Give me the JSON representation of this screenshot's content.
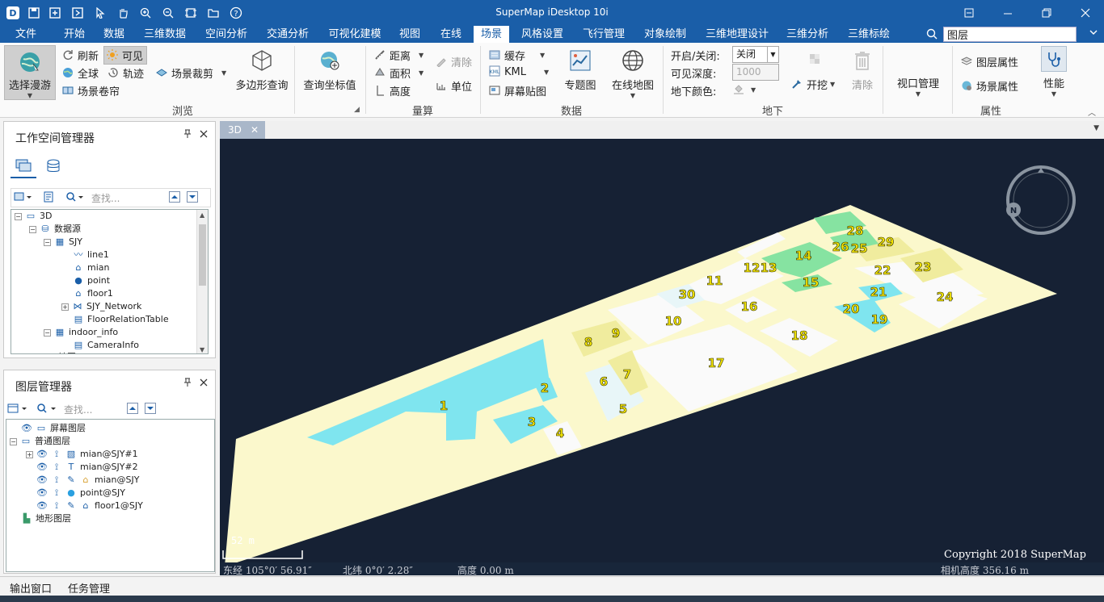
{
  "app": {
    "title": "SuperMap iDesktop 10i"
  },
  "quick_access": [
    "app-logo-icon",
    "save-icon",
    "new-window-icon",
    "window-icon",
    "pointer-icon",
    "pan-icon",
    "zoom-in-icon",
    "zoom-out-icon",
    "full-extent-icon",
    "open-folder-icon",
    "help-icon"
  ],
  "window_controls": {
    "restore_ribbon": "restore-ribbon-icon",
    "minimize": "minimize-icon",
    "maximize": "maximize-icon",
    "close": "close-icon"
  },
  "menu": {
    "items": [
      "文件",
      "开始",
      "数据",
      "三维数据",
      "空间分析",
      "交通分析",
      "可视化建模",
      "视图",
      "在线",
      "场景",
      "风格设置",
      "飞行管理",
      "对象绘制",
      "三维地理设计",
      "三维分析",
      "三维标绘"
    ],
    "active": "场景",
    "search_value": "图层"
  },
  "ribbon": {
    "browse": {
      "label": "浏览",
      "select_roam": "选择漫游",
      "refresh": "刷新",
      "visible": "可见",
      "globe": "全球",
      "track": "轨迹",
      "scene_clip": "场景裁剪",
      "scene_roller": "场景卷帘",
      "polygon_query": "多边形查询",
      "query_coord": "查询坐标值"
    },
    "measure": {
      "label": "量算",
      "distance": "距离",
      "area": "面积",
      "height": "高度",
      "clear": "清除",
      "unit": "单位"
    },
    "data": {
      "label": "数据",
      "cache": "缓存",
      "kml": "KML",
      "screen_overlay": "屏幕贴图",
      "thematic_map": "专题图",
      "online_map": "在线地图"
    },
    "underground": {
      "label": "地下",
      "onoff_label": "开启/关闭:",
      "onoff_value": "关闭",
      "depth_label": "可见深度:",
      "depth_value": "1000",
      "color_label": "地下颜色:",
      "excavate": "开挖",
      "clear": "清除"
    },
    "viewport": {
      "label": "视口管理"
    },
    "properties": {
      "label": "属性",
      "layer_props": "图层属性",
      "scene_props": "场景属性",
      "performance": "性能"
    }
  },
  "workspace_panel": {
    "title": "工作空间管理器",
    "search_placeholder": "查找...",
    "tree": [
      {
        "label": "3D",
        "icon": "scene-icon"
      },
      {
        "label": "数据源",
        "icon": "datasources-icon"
      },
      {
        "label": "SJY",
        "icon": "datasource-icon"
      },
      {
        "label": "line1",
        "icon": "line-dataset-icon"
      },
      {
        "label": "mian",
        "icon": "region-dataset-icon"
      },
      {
        "label": "point",
        "icon": "point-dataset-icon"
      },
      {
        "label": "floor1",
        "icon": "region-dataset-icon"
      },
      {
        "label": "SJY_Network",
        "icon": "network-dataset-icon"
      },
      {
        "label": "FloorRelationTable",
        "icon": "table-dataset-icon"
      },
      {
        "label": "indoor_info",
        "icon": "datasource-icon"
      },
      {
        "label": "CameraInfo",
        "icon": "table-dataset-icon"
      },
      {
        "label": "地图",
        "icon": "maps-icon"
      }
    ]
  },
  "layer_panel": {
    "title": "图层管理器",
    "search_placeholder": "查找...",
    "tree": [
      {
        "label": "屏幕图层",
        "icon": "screen-layer-icon"
      },
      {
        "label": "普通图层",
        "icon": "normal-layers-icon"
      },
      {
        "label": "mian@SJY#1",
        "icon": "theme-layer-icon"
      },
      {
        "label": "mian@SJY#2",
        "icon": "label-theme-icon"
      },
      {
        "label": "mian@SJY",
        "icon": "region-layer-icon"
      },
      {
        "label": "point@SJY",
        "icon": "point-layer-icon"
      },
      {
        "label": "floor1@SJY",
        "icon": "region-layer-icon"
      },
      {
        "label": "地形图层",
        "icon": "terrain-layers-icon"
      }
    ]
  },
  "map": {
    "tab": "3D",
    "building_labels": [
      "1",
      "2",
      "3",
      "4",
      "5",
      "6",
      "7",
      "8",
      "9",
      "10",
      "11",
      "12",
      "13",
      "14",
      "15",
      "16",
      "17",
      "18",
      "19",
      "20",
      "21",
      "22",
      "23",
      "24",
      "25",
      "26",
      "28",
      "29",
      "30"
    ],
    "scale_label": "52 m",
    "longitude": "东经 105°0′ 56.91″",
    "latitude": "北纬 0°0′ 2.28″",
    "altitude": "高度 0.00 m",
    "camera_height": "相机高度 356.16 m",
    "copyright": "Copyright 2018 SuperMap",
    "colors": {
      "ground": "#fbf8cc",
      "cyan": "#7fe5ef",
      "green": "#86e3a1",
      "yellow": "#f0ec9e",
      "white": "#fafafa",
      "label": "#f5e600"
    }
  },
  "bottom": {
    "output_window": "输出窗口",
    "task_manager": "任务管理"
  }
}
